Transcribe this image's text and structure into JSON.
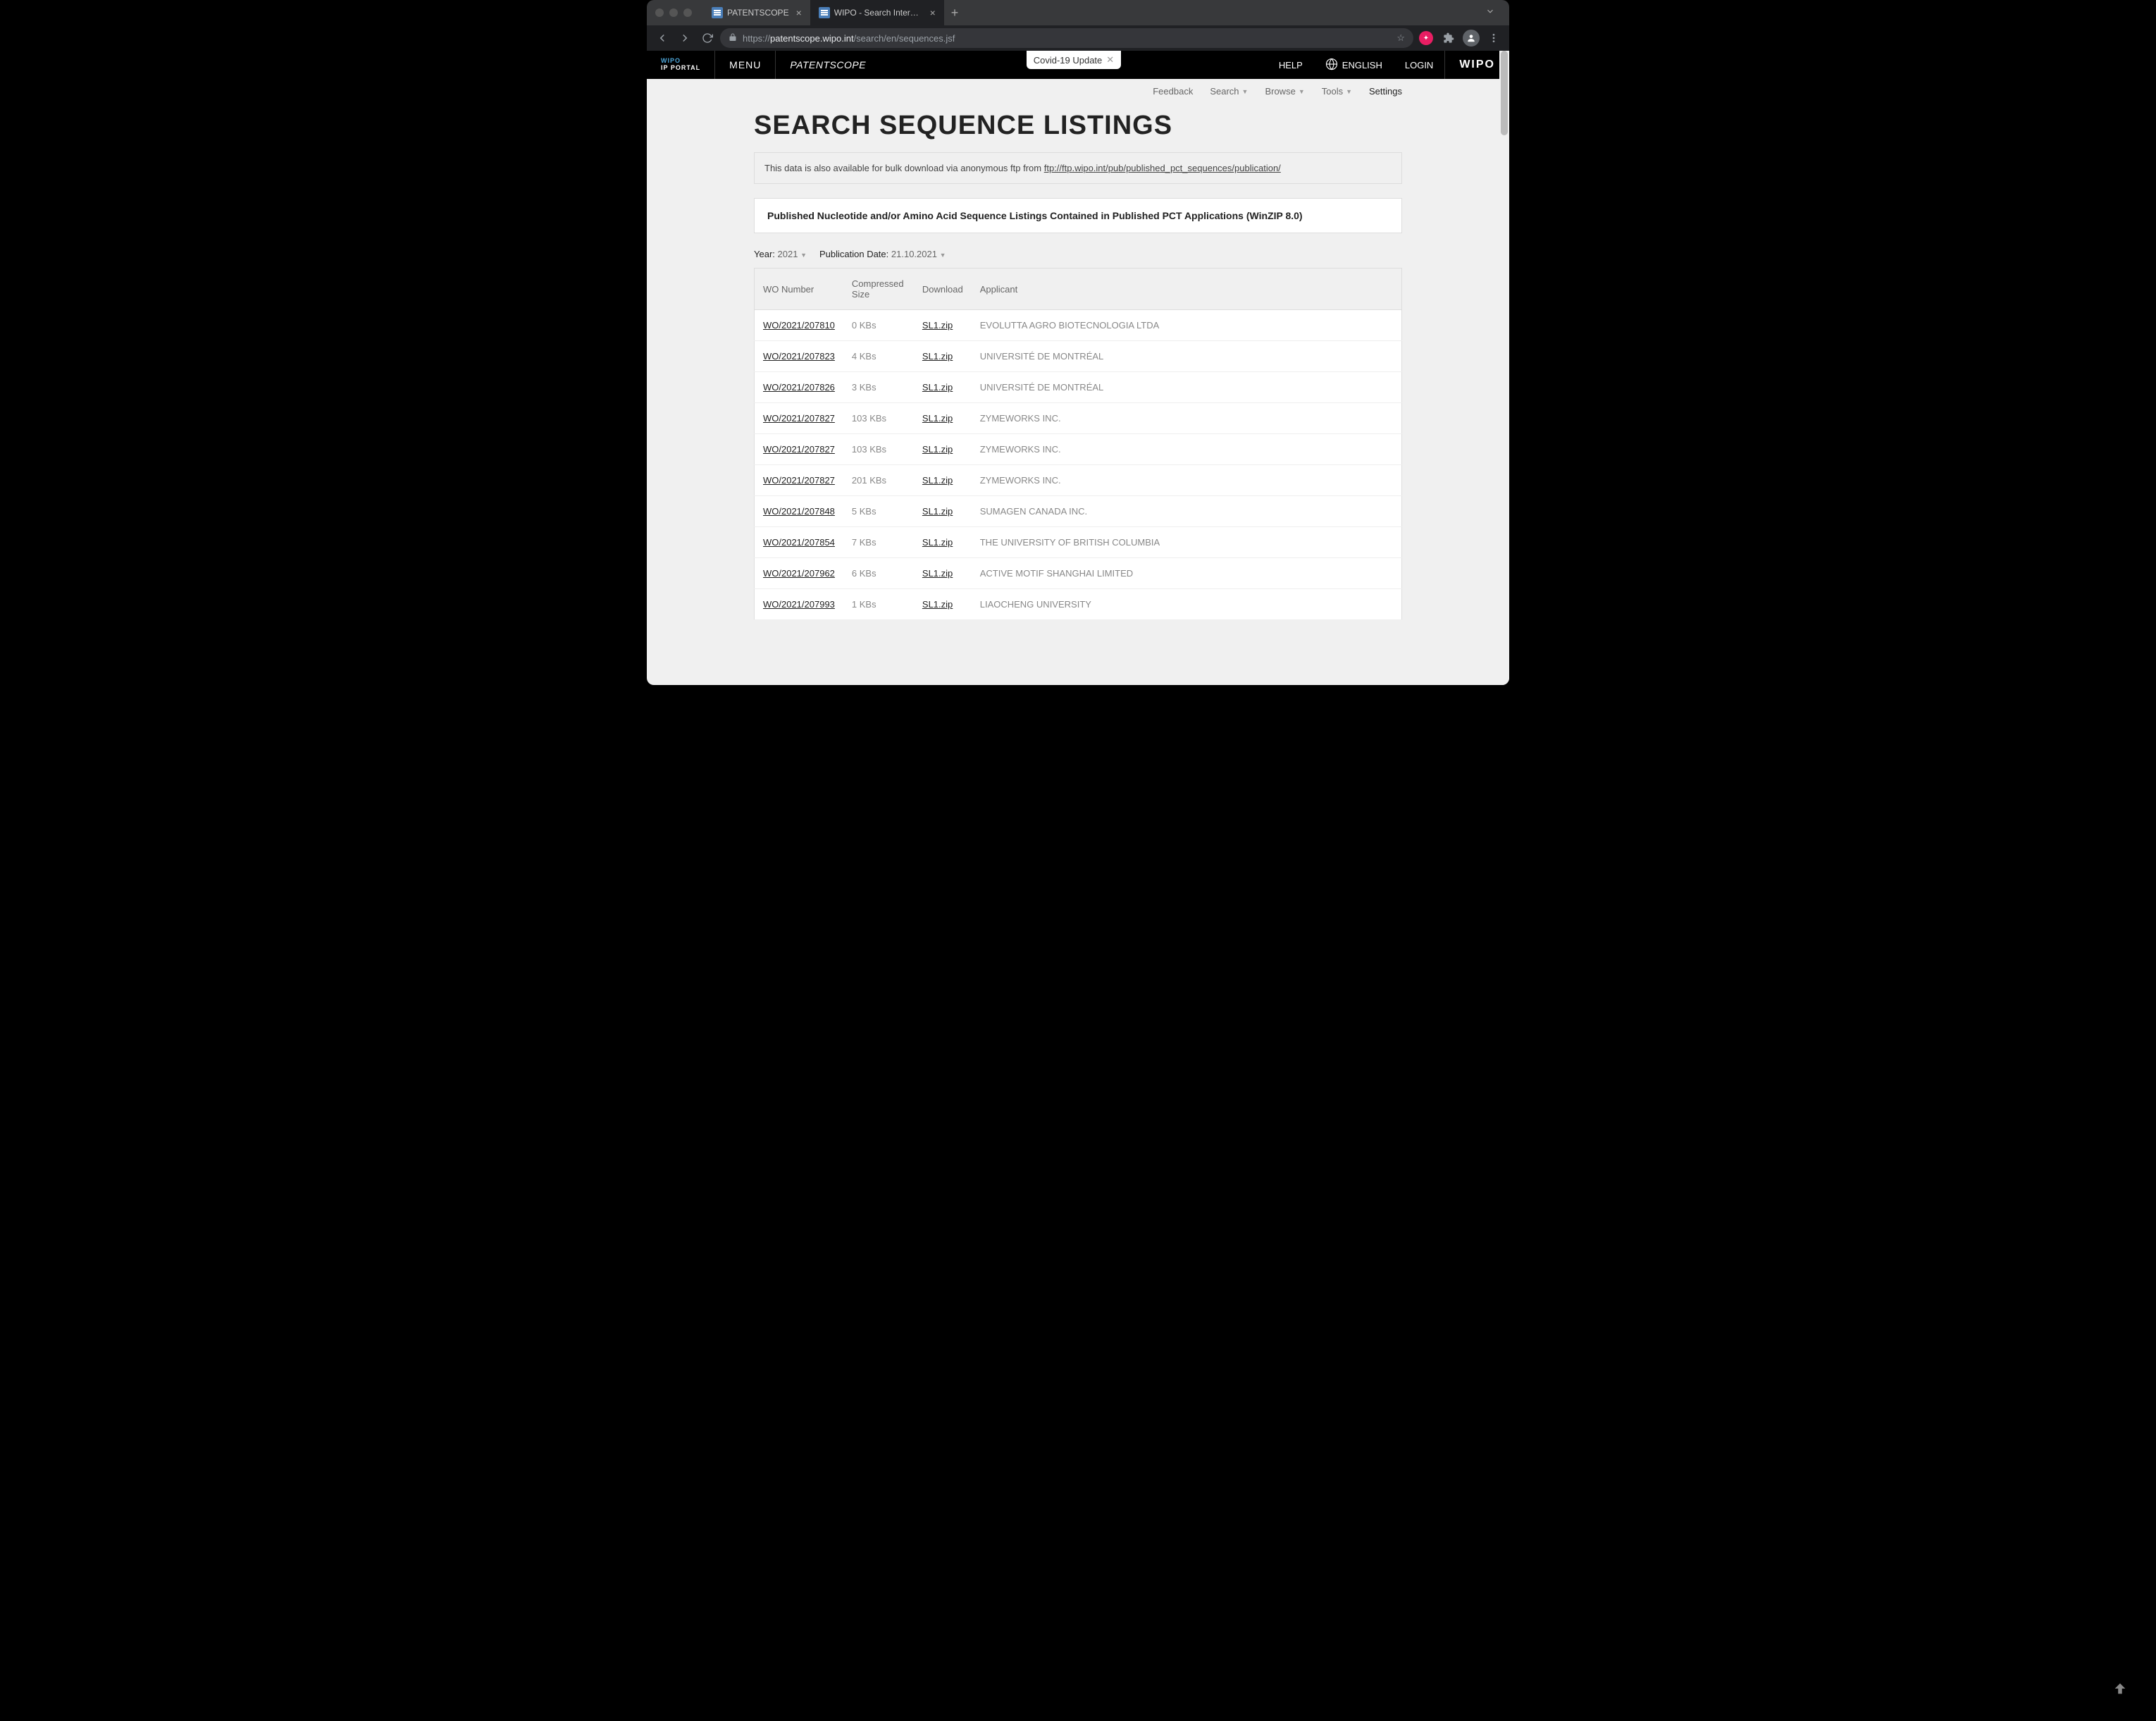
{
  "browser": {
    "tabs": [
      {
        "title": "PATENTSCOPE",
        "active": false
      },
      {
        "title": "WIPO - Search International an",
        "active": true
      }
    ],
    "url_domain": "patentscope.wipo.int",
    "url_prefix": "https://",
    "url_path": "/search/en/sequences.jsf"
  },
  "header": {
    "logo_line1": "WIPO",
    "logo_line2": "IP PORTAL",
    "menu": "MENU",
    "product": "PATENTSCOPE",
    "covid": "Covid-19 Update",
    "help": "HELP",
    "language": "ENGLISH",
    "login": "LOGIN",
    "wipo": "WIPO"
  },
  "subnav": {
    "feedback": "Feedback",
    "search": "Search",
    "browse": "Browse",
    "tools": "Tools",
    "settings": "Settings"
  },
  "page": {
    "title": "SEARCH SEQUENCE LISTINGS",
    "info_prefix": "This data is also available for bulk download via anonymous ftp from ",
    "info_link": "ftp://ftp.wipo.int/pub/published_pct_sequences/publication/",
    "subheading": "Published Nucleotide and/or Amino Acid Sequence Listings Contained in Published PCT Applications (WinZIP 8.0)",
    "year_label": "Year:",
    "year_value": "2021",
    "pubdate_label": "Publication Date:",
    "pubdate_value": "21.10.2021"
  },
  "table": {
    "headers": {
      "wo": "WO Number",
      "size": "Compressed Size",
      "download": "Download",
      "applicant": "Applicant"
    },
    "rows": [
      {
        "wo": "WO/2021/207810",
        "size": "0 KBs",
        "dl": "SL1.zip",
        "applicant": "EVOLUTTA AGRO BIOTECNOLOGIA LTDA"
      },
      {
        "wo": "WO/2021/207823",
        "size": "4 KBs",
        "dl": "SL1.zip",
        "applicant": "UNIVERSITÉ DE MONTRÉAL"
      },
      {
        "wo": "WO/2021/207826",
        "size": "3 KBs",
        "dl": "SL1.zip",
        "applicant": "UNIVERSITÉ DE MONTRÉAL"
      },
      {
        "wo": "WO/2021/207827",
        "size": "103 KBs",
        "dl": "SL1.zip",
        "applicant": "ZYMEWORKS INC."
      },
      {
        "wo": "WO/2021/207827",
        "size": "103 KBs",
        "dl": "SL1.zip",
        "applicant": "ZYMEWORKS INC."
      },
      {
        "wo": "WO/2021/207827",
        "size": "201 KBs",
        "dl": "SL1.zip",
        "applicant": "ZYMEWORKS INC."
      },
      {
        "wo": "WO/2021/207848",
        "size": "5 KBs",
        "dl": "SL1.zip",
        "applicant": "SUMAGEN CANADA INC."
      },
      {
        "wo": "WO/2021/207854",
        "size": "7 KBs",
        "dl": "SL1.zip",
        "applicant": "THE UNIVERSITY OF BRITISH COLUMBIA"
      },
      {
        "wo": "WO/2021/207962",
        "size": "6 KBs",
        "dl": "SL1.zip",
        "applicant": "ACTIVE MOTIF SHANGHAI LIMITED"
      },
      {
        "wo": "WO/2021/207993",
        "size": "1 KBs",
        "dl": "SL1.zip",
        "applicant": "LIAOCHENG UNIVERSITY"
      }
    ]
  }
}
